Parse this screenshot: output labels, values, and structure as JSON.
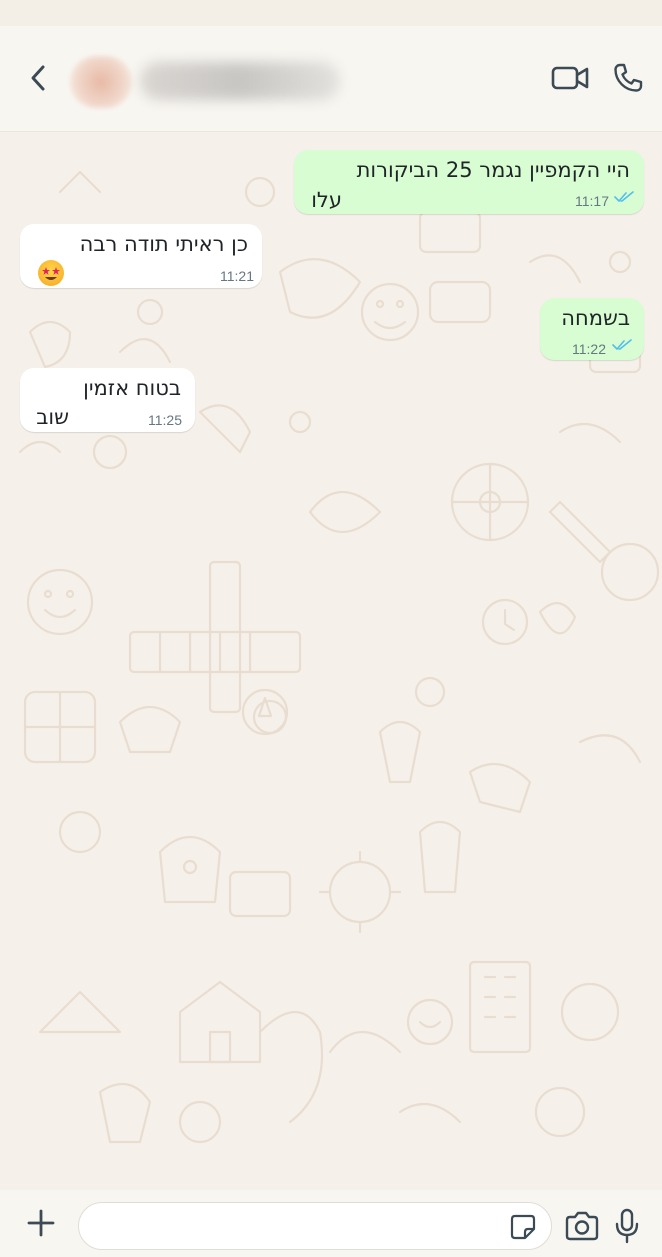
{
  "header": {
    "contact_name": "",
    "icons": {
      "back": "chevron-left-icon",
      "video": "video-camera-icon",
      "call": "phone-icon"
    }
  },
  "messages": [
    {
      "direction": "outgoing",
      "line1": "היי הקמפיין נגמר 25 הביקורות",
      "line2": "עלו",
      "time": "11:17",
      "status": "read"
    },
    {
      "direction": "incoming",
      "line1": "כן ראיתי תודה רבה",
      "line2": "",
      "emoji": "star-struck-emoji",
      "time": "11:21"
    },
    {
      "direction": "outgoing",
      "line1": "בשמחה",
      "line2": "",
      "time": "11:22",
      "status": "read"
    },
    {
      "direction": "incoming",
      "line1": "בטוח אזמין",
      "line2": "שוב",
      "time": "11:25"
    }
  ],
  "composer": {
    "value": "",
    "placeholder": "",
    "icons": {
      "add": "plus-icon",
      "sticker": "sticker-icon",
      "camera": "camera-icon",
      "mic": "microphone-icon"
    }
  },
  "colors": {
    "outgoing_bubble": "#d9fdd3",
    "incoming_bubble": "#ffffff",
    "read_ticks": "#53bdeb",
    "wallpaper": "#f5f1ea"
  }
}
